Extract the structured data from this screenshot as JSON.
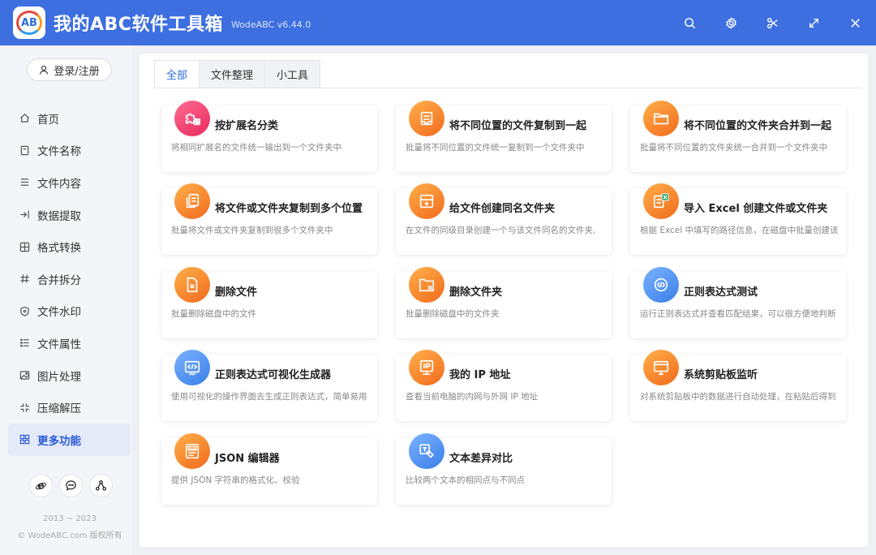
{
  "app": {
    "logo_text": "AB",
    "title": "我的ABC软件工具箱",
    "version": "WodeABC v6.44.0"
  },
  "window_controls": [
    "search-icon",
    "gear-icon",
    "scissors-icon",
    "resize-icon",
    "close-icon"
  ],
  "sidebar": {
    "login_label": "登录/注册",
    "items": [
      {
        "label": "首页",
        "icon": "home-icon"
      },
      {
        "label": "文件名称",
        "icon": "file-icon"
      },
      {
        "label": "文件内容",
        "icon": "list-icon"
      },
      {
        "label": "数据提取",
        "icon": "extract-icon"
      },
      {
        "label": "格式转换",
        "icon": "convert-icon"
      },
      {
        "label": "合并拆分",
        "icon": "hash-icon"
      },
      {
        "label": "文件水印",
        "icon": "shield-icon"
      },
      {
        "label": "文件属性",
        "icon": "properties-icon"
      },
      {
        "label": "图片处理",
        "icon": "image-icon"
      },
      {
        "label": "压缩解压",
        "icon": "compress-icon"
      },
      {
        "label": "更多功能",
        "icon": "grid-icon",
        "active": true
      }
    ],
    "bottom_icons": [
      "browser-icon",
      "chat-icon",
      "share-icon"
    ],
    "copyright_years": "2013 ~ 2023",
    "copyright": "© WodeABC.com 版权所有"
  },
  "tabs": [
    {
      "label": "全部",
      "active": true
    },
    {
      "label": "文件整理"
    },
    {
      "label": "小工具"
    }
  ],
  "cards": [
    {
      "title": "按扩展名分类",
      "desc": "将相同扩展名的文件统一输出到一个文件夹中",
      "icon": "puzzle-icon",
      "color": "pink"
    },
    {
      "title": "将不同位置的文件复制到一起",
      "desc": "批量将不同位置的文件统一复制到一个文件夹中",
      "icon": "inbox-icon",
      "color": "orange"
    },
    {
      "title": "将不同位置的文件夹合并到一起",
      "desc": "批量将不同位置的文件夹统一合并到一个文件夹中",
      "icon": "folder-icon",
      "color": "orange"
    },
    {
      "title": "将文件或文件夹复制到多个位置",
      "desc": "批量将文件或文件夹复制到很多个文件夹中",
      "icon": "copy-icon",
      "color": "orange"
    },
    {
      "title": "给文件创建同名文件夹",
      "desc": "在文件的同级目录创建一个与该文件同名的文件夹,",
      "icon": "folder-plus-icon",
      "color": "orange"
    },
    {
      "title": "导入 Excel 创建文件或文件夹",
      "desc": "根据 Excel 中填写的路径信息，在磁盘中批量创建该",
      "icon": "excel-icon",
      "color": "orange"
    },
    {
      "title": "删除文件",
      "desc": "批量删除磁盘中的文件",
      "icon": "file-delete-icon",
      "color": "orange"
    },
    {
      "title": "删除文件夹",
      "desc": "批量删除磁盘中的文件夹",
      "icon": "folder-delete-icon",
      "color": "orange"
    },
    {
      "title": "正则表达式测试",
      "desc": "运行正则表达式并查看匹配结果，可以很方便地判断",
      "icon": "code-icon",
      "color": "blue"
    },
    {
      "title": "正则表达式可视化生成器",
      "desc": "使用可视化的操作界面去生成正则表达式，简单易用",
      "icon": "code-window-icon",
      "color": "blue"
    },
    {
      "title": "我的 IP 地址",
      "desc": "查看当前电脑的内网与外网 IP 地址",
      "icon": "ip-icon",
      "color": "orange"
    },
    {
      "title": "系统剪贴板监听",
      "desc": "对系统剪贴板中的数据进行自动处理，在粘贴后得到",
      "icon": "monitor-icon",
      "color": "orange"
    },
    {
      "title": "JSON 编辑器",
      "desc": "提供 JSON 字符串的格式化、校验",
      "icon": "json-icon",
      "color": "orange"
    },
    {
      "title": "文本差异对比",
      "desc": "比较两个文本的相同点与不同点",
      "icon": "text-compare-icon",
      "color": "blue"
    }
  ]
}
